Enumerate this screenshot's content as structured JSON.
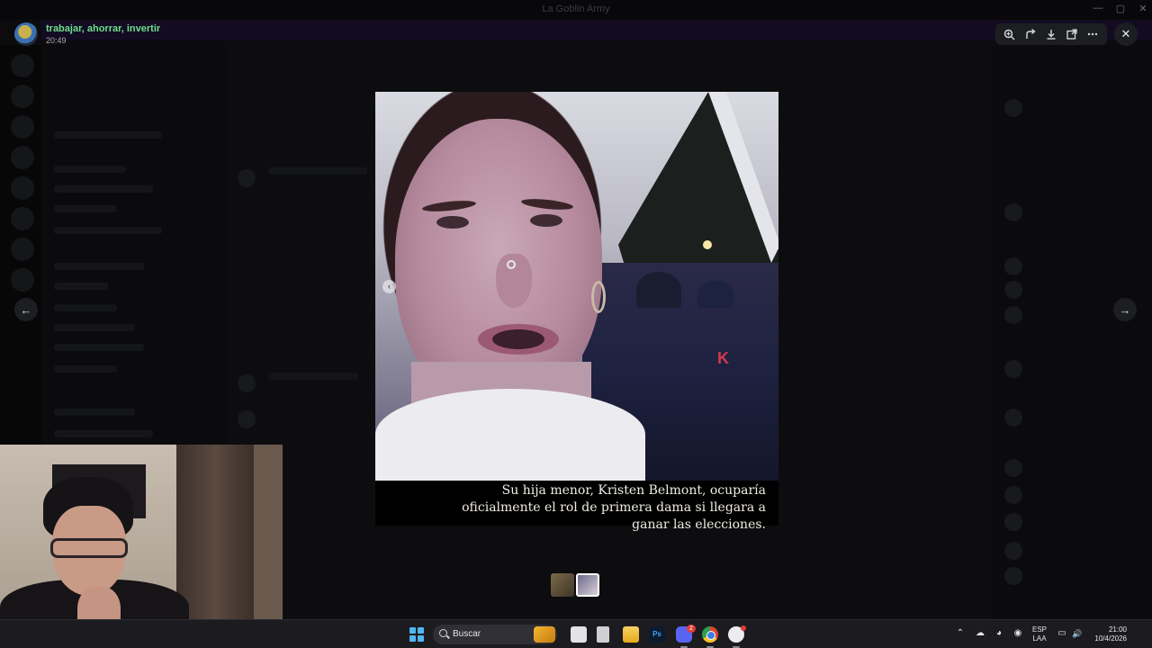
{
  "window": {
    "title": "La Goblin Army"
  },
  "viewer": {
    "channel": "trabajar, ahorrar, invertir",
    "time": "20:49",
    "tools": [
      {
        "name": "zoom-icon",
        "glyph": "⌕"
      },
      {
        "name": "forward-icon",
        "glyph": "↱"
      },
      {
        "name": "download-icon",
        "glyph": "⤓"
      },
      {
        "name": "open-external-icon",
        "glyph": "⧉"
      },
      {
        "name": "more-icon",
        "glyph": "⋯"
      }
    ],
    "close_glyph": "✕",
    "prev_glyph": "←",
    "next_glyph": "→",
    "media_prev_glyph": "‹",
    "caption": "Su hija menor, Kristen Belmont, ocuparía oficialmente el rol de primera dama si llegara a ganar las elecciones."
  },
  "taskbar": {
    "search_placeholder": "Buscar",
    "photoshop_label": "Ps",
    "discord_badge": "2",
    "language": {
      "line1": "ESP",
      "line2": "LAA"
    },
    "clock": {
      "time": "21:00",
      "date": "10/4/2026"
    },
    "tray": [
      {
        "name": "chevron-up-icon",
        "glyph": "⌃"
      },
      {
        "name": "cloud-icon",
        "glyph": "☁"
      },
      {
        "name": "edge-icon",
        "glyph": "◕"
      },
      {
        "name": "shield-icon",
        "glyph": "◉"
      },
      {
        "name": "microphone-icon",
        "glyph": "🎙"
      }
    ],
    "tray_right": [
      {
        "name": "network-icon",
        "glyph": "▭"
      },
      {
        "name": "volume-icon",
        "glyph": "🔊"
      },
      {
        "name": "battery-icon",
        "glyph": "▮"
      }
    ]
  },
  "colors": {
    "channel_green": "#6ddf8a",
    "discord_blurple": "#5865f2",
    "notification_red": "#e23b3b"
  }
}
